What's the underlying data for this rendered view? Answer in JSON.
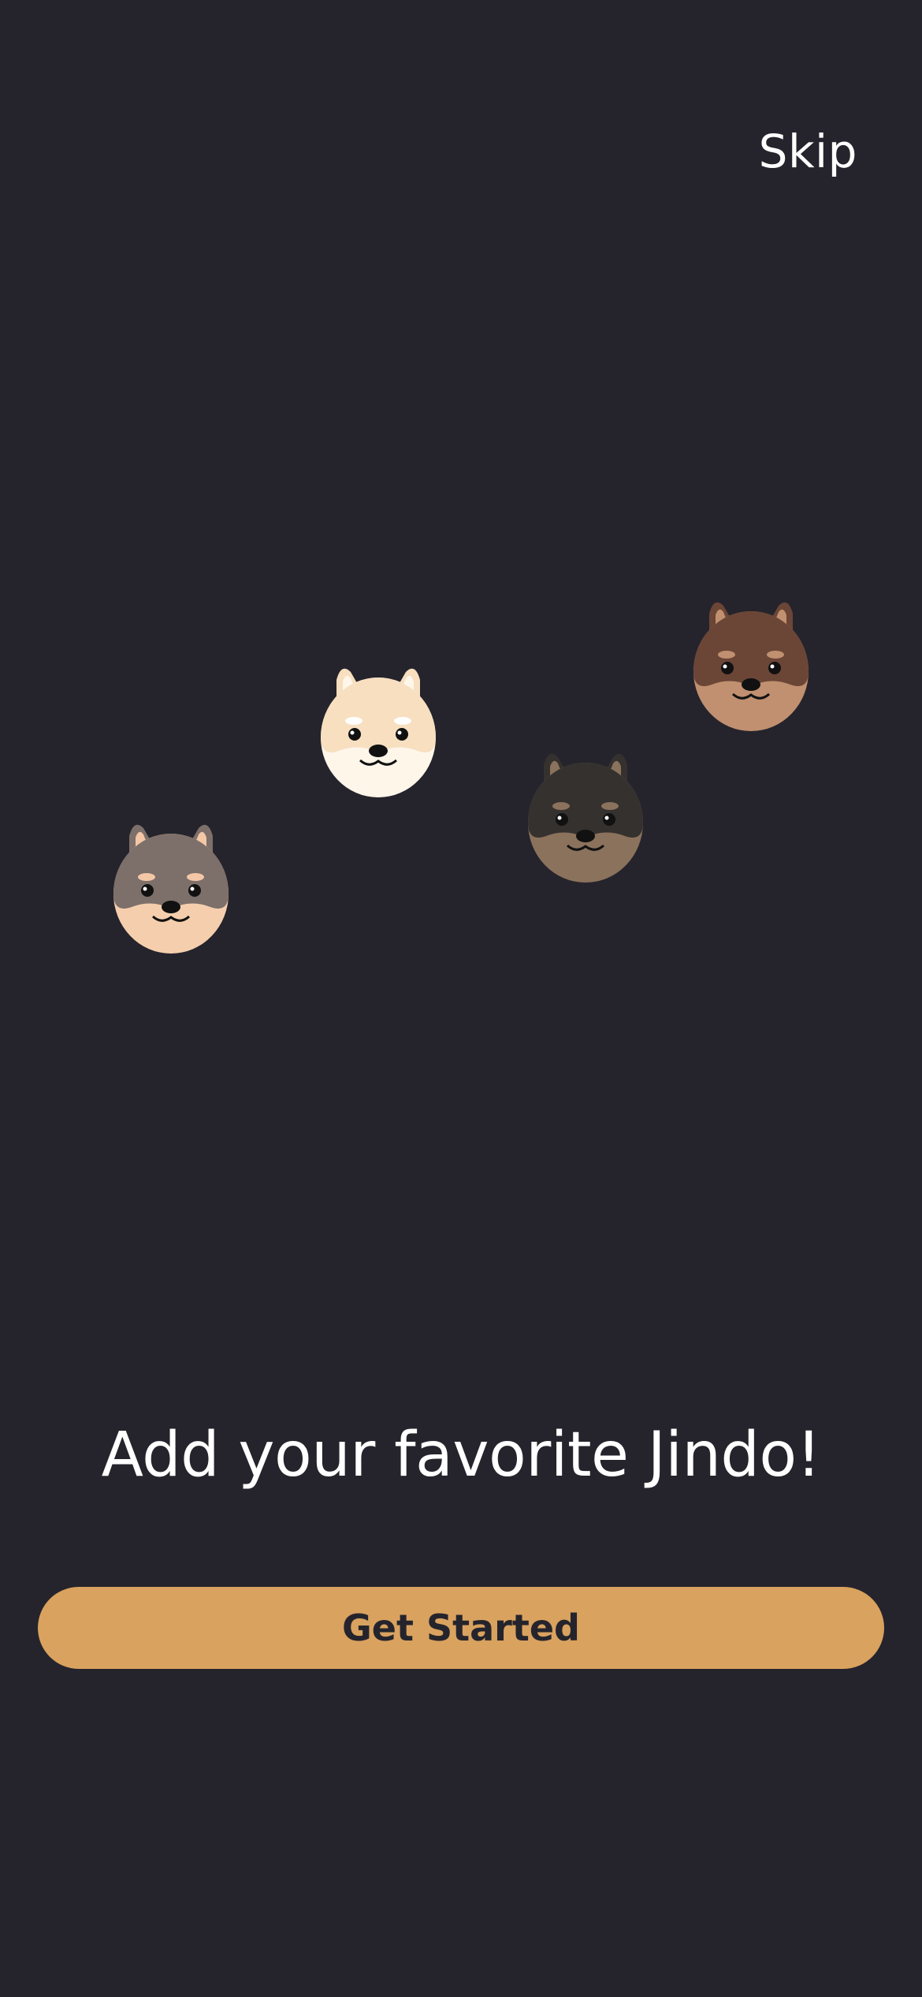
{
  "header": {
    "skip_label": "Skip"
  },
  "illustration": {
    "dogs": [
      {
        "icon": "jindo-gray-dog-icon",
        "head": "#7d6f6a",
        "face": "#f5cfad",
        "ear_inner": "#f4c7a7",
        "brow": "#f4c7a7"
      },
      {
        "icon": "jindo-cream-dog-icon",
        "head": "#f7dfc0",
        "face": "#fff6ea",
        "ear_inner": "#fff6ea",
        "brow": "#ffffff"
      },
      {
        "icon": "jindo-black-dog-icon",
        "head": "#35312f",
        "face": "#8b725c",
        "ear_inner": "#8b725c",
        "brow": "#8b725c"
      },
      {
        "icon": "jindo-brown-dog-icon",
        "head": "#6b4536",
        "face": "#c09070",
        "ear_inner": "#c09070",
        "brow": "#c09070"
      }
    ]
  },
  "onboarding": {
    "headline": "Add your favorite Jindo!",
    "cta_label": "Get Started"
  },
  "colors": {
    "background": "#25242c",
    "accent": "#d9a25f",
    "text": "#ffffff"
  }
}
